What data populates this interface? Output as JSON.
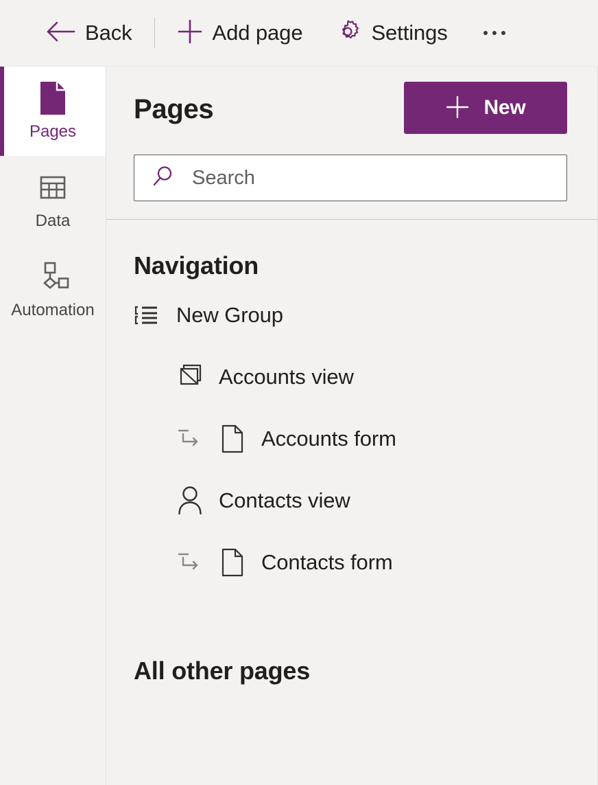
{
  "commandbar": {
    "back": {
      "label": "Back",
      "icon": "arrow-left-icon"
    },
    "add_page": {
      "label": "Add page",
      "icon": "plus-icon"
    },
    "settings": {
      "label": "Settings",
      "icon": "gear-icon"
    },
    "overflow": {
      "label": "More commands",
      "icon": "ellipsis-icon"
    }
  },
  "rail": {
    "items": [
      {
        "label": "Pages",
        "icon": "page-icon",
        "selected": true
      },
      {
        "label": "Data",
        "icon": "table-icon",
        "selected": false
      },
      {
        "label": "Automation",
        "icon": "flowchart-icon",
        "selected": false
      }
    ]
  },
  "panel": {
    "title": "Pages",
    "new_button": {
      "label": "New",
      "icon": "plus-icon"
    },
    "search": {
      "placeholder": "Search",
      "value": "",
      "icon": "search-icon"
    },
    "sections": [
      {
        "title": "Navigation"
      },
      {
        "title": "All other pages"
      }
    ],
    "tree": [
      {
        "label": "New Group",
        "icon": "group-list-icon",
        "level": 1,
        "sub_arrow": false
      },
      {
        "label": "Accounts view",
        "icon": "stacked-pages-icon",
        "level": 2,
        "sub_arrow": false
      },
      {
        "label": "Accounts form",
        "icon": "page-outline-icon",
        "level": 2,
        "sub_arrow": true
      },
      {
        "label": "Contacts view",
        "icon": "person-icon",
        "level": 2,
        "sub_arrow": false
      },
      {
        "label": "Contacts form",
        "icon": "page-outline-icon",
        "level": 2,
        "sub_arrow": true
      }
    ]
  },
  "colors": {
    "accent": "#742774",
    "app_background": "#f3f2f1",
    "selected_background": "#ffffff",
    "text": "#201f1e",
    "muted_text": "#605e5c",
    "border": "#c8c6c4"
  }
}
